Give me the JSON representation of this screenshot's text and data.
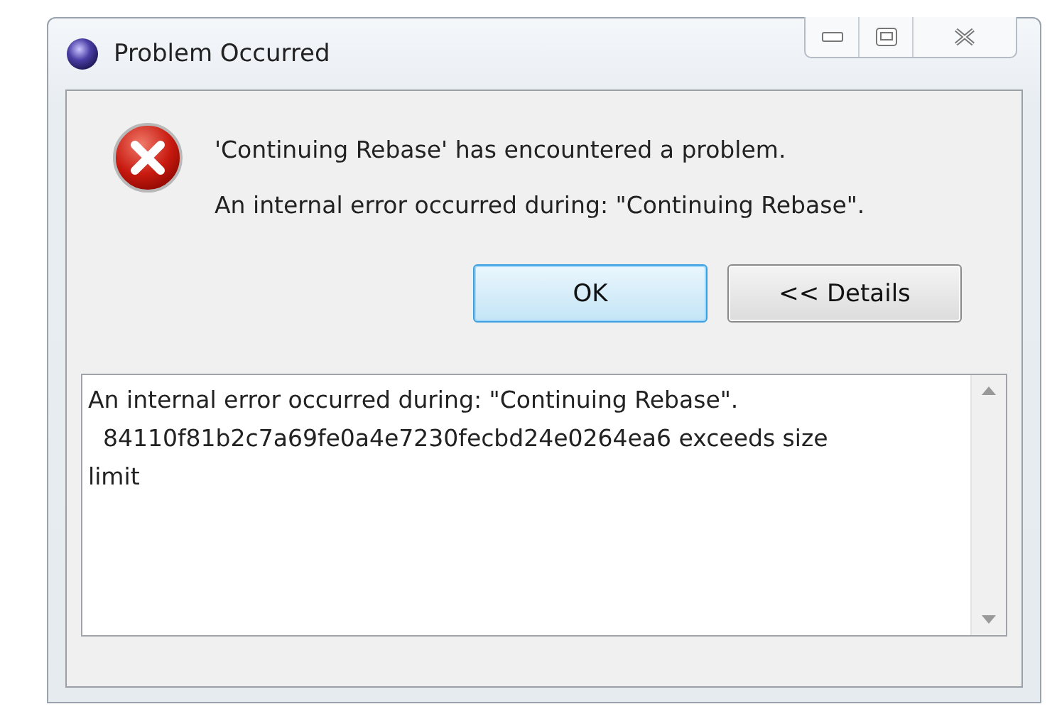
{
  "window": {
    "title": "Problem Occurred"
  },
  "message": {
    "headline": "'Continuing Rebase' has encountered a problem.",
    "detail": "An internal error occurred during: \"Continuing Rebase\"."
  },
  "buttons": [
    {
      "label": "OK",
      "default": true
    },
    {
      "label": "<< Details",
      "default": false
    }
  ],
  "details": [
    "An internal error occurred during: \"Continuing Rebase\".",
    "  84110f81b2c7a69fe0a4e7230fecbd24e0264ea6 exceeds size limit"
  ]
}
